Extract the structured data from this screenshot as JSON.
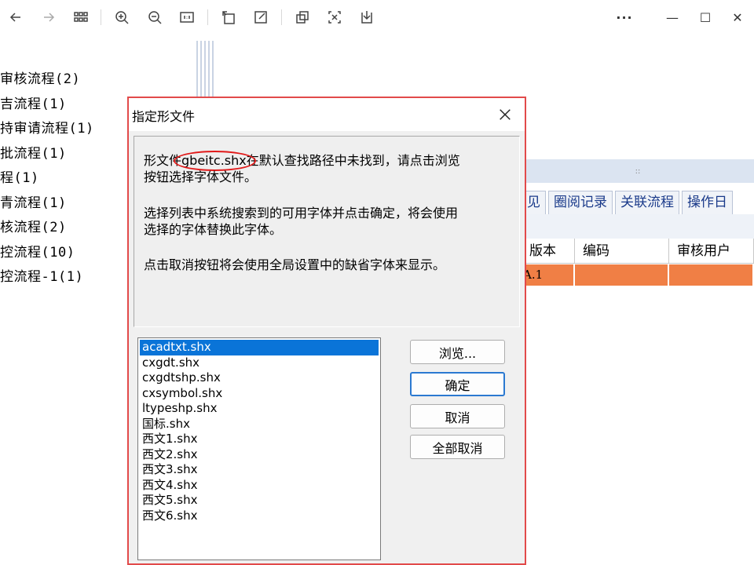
{
  "toolbar": {
    "icons": [
      "back-icon",
      "forward-icon",
      "grid-icon",
      "zoom-in-icon",
      "zoom-out-icon",
      "fit-icon",
      "rotate-icon",
      "edit-icon",
      "layers-icon",
      "select-icon",
      "save-icon"
    ],
    "more_label": "···",
    "minimize_label": "—",
    "maximize_label": "☐",
    "close_label": "✕"
  },
  "tree": {
    "items": [
      "审核流程(2)",
      "吉流程(1)",
      "持审请流程(1)",
      "批流程(1)",
      "程(1)",
      "青流程(1)",
      "核流程(2)",
      "控流程(10)",
      "控流程-1(1)"
    ]
  },
  "background_panel": {
    "header_text": "::",
    "tabs": [
      "见",
      "圈阅记录",
      "关联流程",
      "操作日"
    ],
    "columns": [
      "版本",
      "编码",
      "审核用户"
    ],
    "row": [
      "A.1",
      "",
      ""
    ],
    "row_color": "#f07f45"
  },
  "dialog": {
    "title": "指定形文件",
    "message": {
      "line1_prefix": "形文件",
      "filename": "gbeitc.shx",
      "line1_suffix": "在默认查找路径中未找到，请点击浏览",
      "line2": "按钮选择字体文件。",
      "line3": "选择列表中系统搜索到的可用字体并点击确定，将会使用",
      "line4": "选择的字体替换此字体。",
      "line5": "点击取消按钮将会使用全局设置中的缺省字体来显示。"
    },
    "font_list": [
      "acadtxt.shx",
      "cxgdt.shx",
      "cxgdtshp.shx",
      "cxsymbol.shx",
      "ltypeshp.shx",
      "国标.shx",
      "西文1.shx",
      "西文2.shx",
      "西文3.shx",
      "西文4.shx",
      "西文5.shx",
      "西文6.shx"
    ],
    "selected_index": 0,
    "buttons": {
      "browse": "浏览...",
      "ok": "确定",
      "cancel": "取消",
      "cancel_all": "全部取消"
    },
    "highlight_color": "#e11a1a",
    "selection_color": "#0a74d8"
  }
}
